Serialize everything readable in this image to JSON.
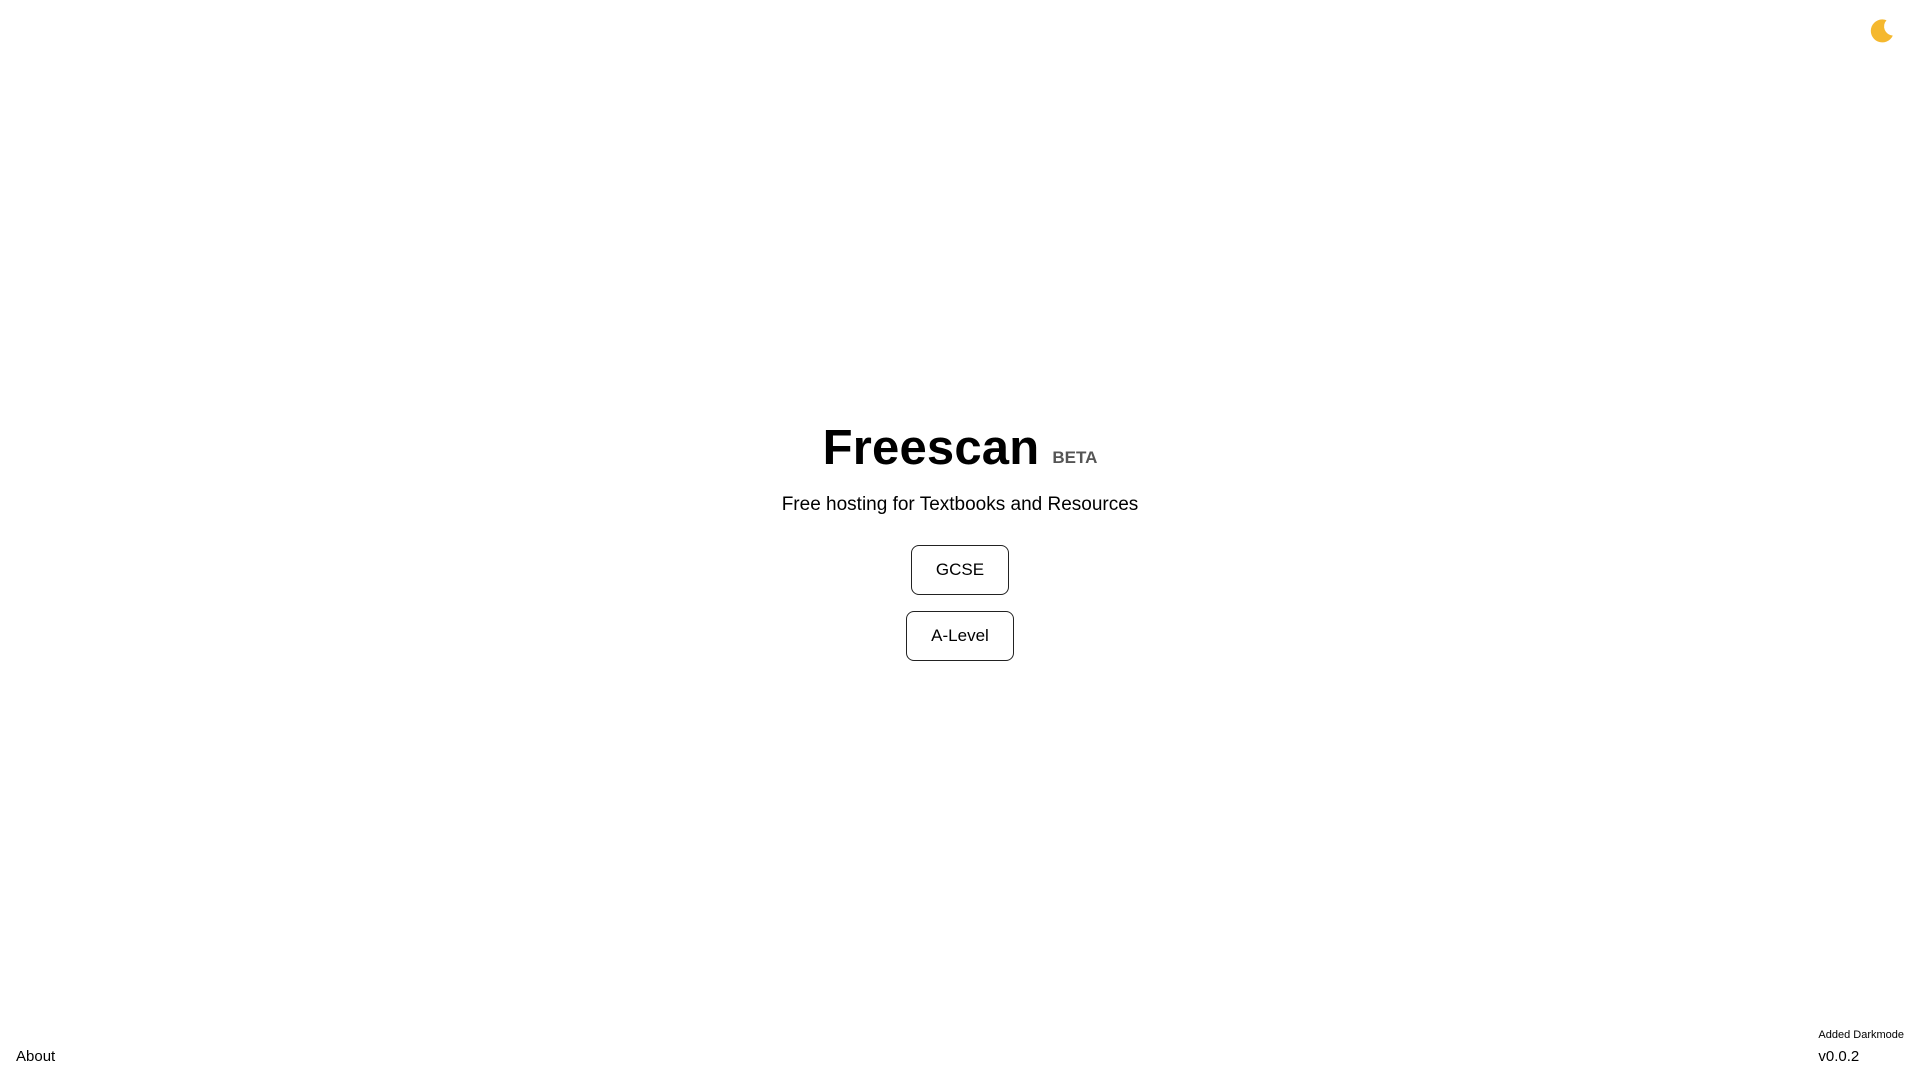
{
  "header": {
    "theme_toggle_icon": "crescent-moon-icon",
    "moon_color": "#F5B82E"
  },
  "hero": {
    "title": "Freescan",
    "badge": "BETA",
    "subtitle": "Free hosting for Textbooks and Resources"
  },
  "buttons": {
    "gcse_label": "GCSE",
    "alevel_label": "A-Level"
  },
  "footer": {
    "about_link": "About",
    "changelog": "Added Darkmode",
    "version": "v0.0.2"
  }
}
